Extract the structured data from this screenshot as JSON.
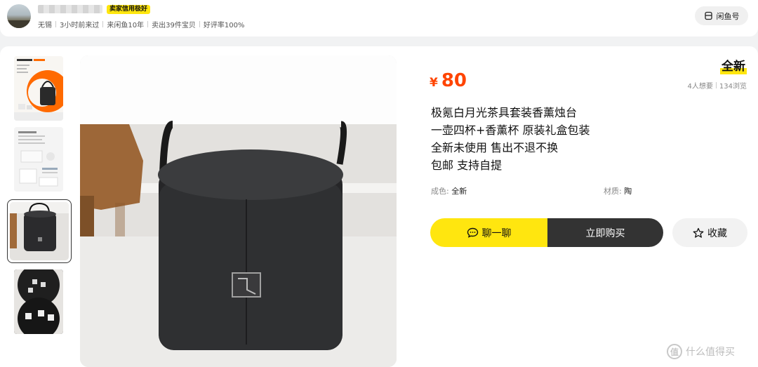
{
  "seller": {
    "credit_badge": "卖家信用极好",
    "meta": [
      "无锡",
      "3小时前来过",
      "来闲鱼10年",
      "卖出39件宝贝",
      "好评率100%"
    ],
    "xianyu_button": "闲鱼号"
  },
  "product": {
    "price_symbol": "¥",
    "price": "80",
    "condition": "全新",
    "want_count": "4人想要",
    "views": "134浏览",
    "description_lines": [
      "极氪白月光茶具套装香薰烛台",
      "一壶四杯+香薰杯 原装礼盒包装",
      "全新未使用 售出不退不换",
      "包邮 支持自提"
    ],
    "attributes": [
      {
        "key": "成色: ",
        "value": "全新"
      },
      {
        "key": "材质: ",
        "value": "陶"
      }
    ]
  },
  "actions": {
    "chat": "聊一聊",
    "buy": "立即购买",
    "favorite": "收藏"
  },
  "thumbnails": [
    "product-promo-thumbnail",
    "product-detail-thumbnail",
    "product-box-thumbnail",
    "product-box-open-thumbnail"
  ],
  "watermark": {
    "logo": "值",
    "text": "什么值得买"
  },
  "colors": {
    "brand_yellow": "#ffe60f",
    "price_orange": "#ff4400",
    "buy_dark": "#333333"
  }
}
